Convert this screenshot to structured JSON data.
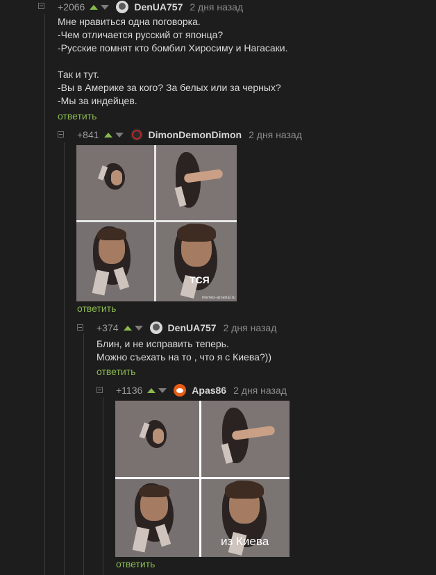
{
  "comments": [
    {
      "rating": "+2066",
      "nick": "DenUA757",
      "time": "2 дня назад",
      "lines": [
        "Мне нравиться одна поговорка.",
        "-Чем отличается русский от японца?",
        "-Русские помнят кто бомбил Хиросиму и Нагасаки.",
        "",
        "Так и тут.",
        "-Вы в Америке за кого? За белых или за черных?",
        "-Мы за индейцев."
      ],
      "reply": "ответить"
    },
    {
      "rating": "+841",
      "nick": "DimonDemonDimon",
      "time": "2 дня назад",
      "image": {
        "caption": "ТСЯ",
        "watermark": "memes-arsenal.ru"
      },
      "reply": "ответить"
    },
    {
      "rating": "+374",
      "nick": "DenUA757",
      "time": "2 дня назад",
      "lines": [
        "Блин, и не исправить теперь.",
        "Можно съехать на то , что я с Киева?))"
      ],
      "reply": "ответить"
    },
    {
      "rating": "+1136",
      "nick": "Apas86",
      "time": "2 дня назад",
      "image": {
        "caption": "из Киева"
      },
      "reply": "ответить"
    }
  ],
  "colors": {
    "background": "#1d1d1d",
    "accent_green": "#8ab94f",
    "rating_gray": "#9d9d9d"
  }
}
